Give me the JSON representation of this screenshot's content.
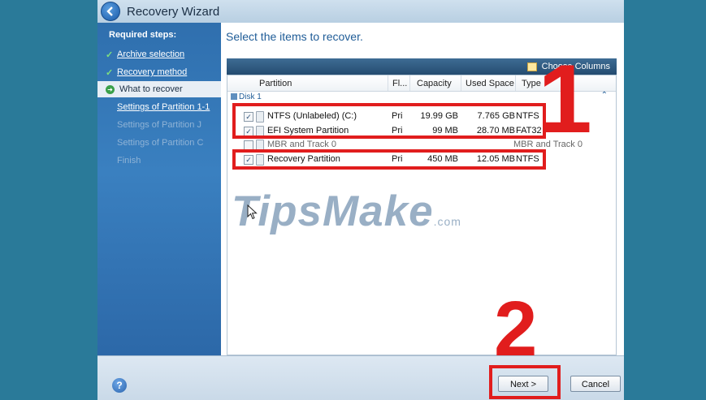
{
  "window": {
    "title": "Recovery Wizard"
  },
  "sidebar": {
    "heading": "Required steps:",
    "items": [
      {
        "label": "Archive selection",
        "state": "done"
      },
      {
        "label": "Recovery method",
        "state": "done"
      },
      {
        "label": "What to recover",
        "state": "current"
      },
      {
        "label": "Settings of Partition 1-1",
        "state": "next"
      },
      {
        "label": "Settings of Partition J",
        "state": "dim"
      },
      {
        "label": "Settings of Partition C",
        "state": "dim"
      },
      {
        "label": "Finish",
        "state": "dim"
      }
    ]
  },
  "main": {
    "heading": "Select the items to recover.",
    "toolbar": {
      "choose_columns": "Choose Columns"
    },
    "columns": [
      "Partition",
      "Fl...",
      "Capacity",
      "Used Space",
      "Type"
    ],
    "group": "Disk 1",
    "rows": [
      {
        "checked": true,
        "name": "NTFS (Unlabeled) (C:)",
        "flags": "Pri",
        "capacity": "19.99 GB",
        "used": "7.765 GB",
        "type": "NTFS"
      },
      {
        "checked": true,
        "name": "EFI System Partition",
        "flags": "Pri",
        "capacity": "99 MB",
        "used": "28.70 MB",
        "type": "FAT32"
      },
      {
        "checked": false,
        "name": "MBR and Track 0",
        "flags": "",
        "capacity": "",
        "used": "",
        "type": "MBR and Track 0"
      },
      {
        "checked": true,
        "name": "Recovery Partition",
        "flags": "Pri",
        "capacity": "450 MB",
        "used": "12.05 MB",
        "type": "NTFS"
      }
    ]
  },
  "watermark": {
    "text": "TipsMake",
    "tld": ".com"
  },
  "footer": {
    "next": "Next >",
    "cancel": "Cancel"
  },
  "annotations": {
    "one": "1",
    "two": "2"
  },
  "colors": {
    "annotation_red": "#e11d1d",
    "background": "#2a7a99",
    "sidebar_blue": "#3a80c0"
  }
}
